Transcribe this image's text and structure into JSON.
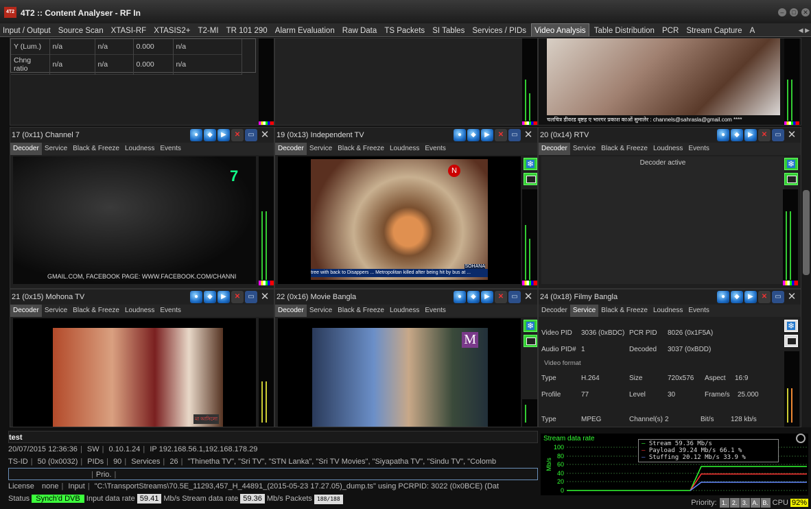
{
  "window": {
    "title": "4T2 :: Content Analyser - RF In",
    "icon_text": "4T2"
  },
  "tabs": [
    "Input / Output",
    "Source Scan",
    "XTASI-RF",
    "XTASIS2+",
    "T2-MI",
    "TR 101 290",
    "Alarm Evaluation",
    "Raw Data",
    "TS Packets",
    "SI Tables",
    "Services / PIDs",
    "Video Analysis",
    "Table Distribution",
    "PCR",
    "Stream Capture",
    "A"
  ],
  "active_tab": "Video Analysis",
  "subtabs": [
    "Decoder",
    "Service",
    "Black & Freeze",
    "Loudness",
    "Events"
  ],
  "top_pane": {
    "rows": [
      [
        "Y (Lum.)",
        "n/a",
        "n/a",
        "0.000",
        "n/a"
      ],
      [
        "Chng ratio",
        "n/a",
        "n/a",
        "0.000",
        "n/a"
      ]
    ],
    "caption": "चलचित्र डीवरड बृष्टह ए भारगर प्रकाश काओं सुमालेर : channels@sahrasla@gmail.com ****"
  },
  "panes": [
    {
      "name": "17 (0x11) Channel 7",
      "ticker": "GMAIL.COM, FACEBOOK PAGE: WWW.FACEBOOK.COM/CHANNI",
      "logo": "7"
    },
    {
      "name": "19 (0x13) Independent TV",
      "ticker": "tree with back to Disappers ... Metropolitan killed after being hit by bus at ...",
      "logo": "N",
      "logo2": "SOHANA"
    },
    {
      "name": "20 (0x14) RTV",
      "status": "Decoder active"
    },
    {
      "name": "21 (0x15) Mohona TV",
      "logo": "মা আসিলো"
    },
    {
      "name": "22 (0x16) Movie Bangla",
      "logo": "M"
    },
    {
      "name": "24 (0x18) Filmy Bangla"
    }
  ],
  "service_info": {
    "video_pid_label": "Video PID",
    "video_pid": "3036 (0xBDC)",
    "pcr_pid_label": "PCR PID",
    "pcr_pid": "8026 (0x1F5A)",
    "audio_pid_label": "Audio PID#",
    "audio_pid": "1",
    "decoded_label": "Decoded",
    "decoded": "3037 (0xBDD)",
    "video_format_label": "Video format",
    "type_label": "Type",
    "type": "H.264",
    "size_label": "Size",
    "size": "720x576",
    "aspect_label": "Aspect",
    "aspect": "16:9",
    "profile_label": "Profile",
    "profile": "77",
    "level_label": "Level",
    "level": "30",
    "frame_label": "Frame/s",
    "frame": "25.000",
    "atype_label": "Type",
    "atype": "MPEG",
    "channels_label": "Channel(s)",
    "channels": "2",
    "bitrate_label": "Bit/s",
    "bitrate": "128 kb/s"
  },
  "status": {
    "name": "test",
    "datetime": "20/07/2015 12:36:36",
    "sw_label": "SW",
    "sw": "0.10.1.24",
    "ip_label": "IP",
    "ip": "192.168.56.1,192.168.178.29",
    "tsid_label": "TS-ID",
    "tsid": "50 (0x0032)",
    "pids_label": "PIDs",
    "pids": "90",
    "services_label": "Services",
    "services_count": "26",
    "services_list": "\"Thinetha TV\", \"Sri TV\", \"STN Lanka\", \"Sri TV Movies\", \"Siyapatha TV\", \"Sindu TV\", \"Colomb",
    "prio_label": "Prio.",
    "license_label": "License",
    "license": "none",
    "input_label": "Input",
    "input": "\"C:\\TransportStreams\\70.5E_11293,457_H_44891_(2015-05-23 17.27.05)_dump.ts\" using PCRPID: 3022 (0x0BCE) (Dat",
    "status_label": "Status",
    "status_value": "Synch'd DVB",
    "input_rate_label": "Input data rate",
    "input_rate": "59.41",
    "stream_rate_label": "Mb/s Stream data rate",
    "stream_rate": "59.36",
    "packets_label": "Mb/s Packets",
    "packets": "188/188",
    "priority_label": "Priority:",
    "priority_buttons": [
      "1.",
      "2.",
      "3.",
      "A.",
      "B."
    ],
    "cpu_label": "CPU",
    "cpu": "92%"
  },
  "graph": {
    "title": "Stream data rate",
    "ylabel": "Mb/s",
    "yticks": [
      "100",
      "80",
      "60",
      "40",
      "20",
      "0"
    ],
    "legend": [
      {
        "name": "Stream",
        "value": "59.36 Mb/s",
        "pct": "",
        "color": "#33ff33"
      },
      {
        "name": "Payload",
        "value": "39.24 Mb/s",
        "pct": "66.1 %",
        "color": "#ff3333"
      },
      {
        "name": "Stuffing",
        "value": "20.12 Mb/s",
        "pct": "33.9 %",
        "color": "#6688ff"
      }
    ]
  },
  "colors": {
    "green": "#33ff33",
    "accent_blue": "#1e6fc8",
    "cpu": "#eeee00"
  }
}
